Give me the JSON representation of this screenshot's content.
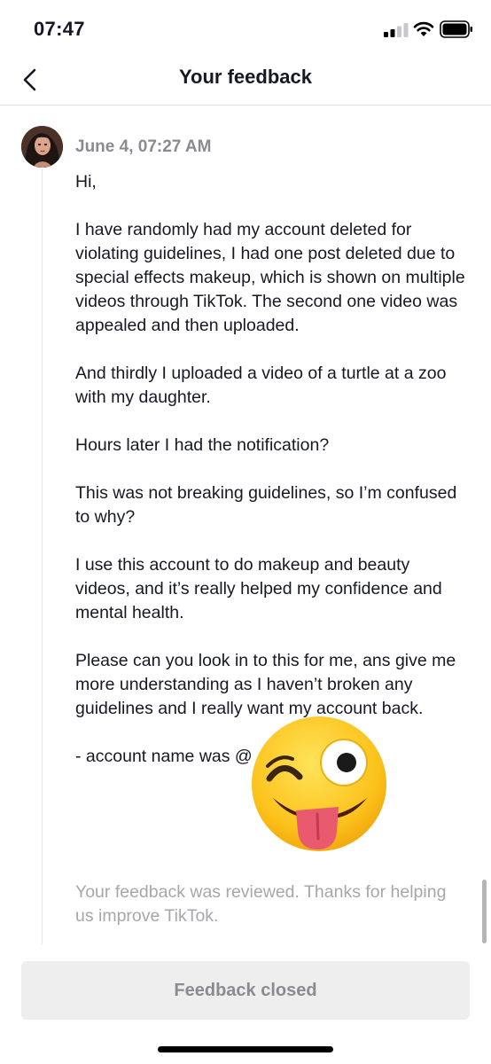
{
  "status_bar": {
    "time": "07:47"
  },
  "header": {
    "title": "Your feedback"
  },
  "message": {
    "date": "June 4, 07:27 AM",
    "paragraphs": [
      "Hi,",
      "I have randomly had my account deleted for violating guidelines, I had one post deleted due to special effects makeup, which is shown on multiple videos through TikTok. The second one video was appealed and then uploaded.",
      "And thirdly I uploaded a video of a turtle at a zoo with my daughter.",
      "Hours later I had the notification?",
      "This was not breaking guidelines, so I’m confused to why?",
      "I use this account to do makeup and beauty videos, and it’s really helped my confidence and mental health.",
      "Please can you look in to this for me, ans give me more understanding as I haven’t broken any guidelines and I really want my account back.",
      "- account name was @"
    ]
  },
  "reviewed_note": "Your feedback was reviewed. Thanks for helping us improve TikTok.",
  "footer": {
    "closed_label": "Feedback closed"
  },
  "colors": {
    "text": "#161823",
    "muted": "#8a8b91",
    "note": "#a6a7ab",
    "closed_bg": "#eeeeef"
  },
  "icons": {
    "back": "chevron-left-icon",
    "signal": "signal-icon",
    "wifi": "wifi-icon",
    "battery": "battery-icon",
    "sticker": "winking-tongue-emoji"
  }
}
